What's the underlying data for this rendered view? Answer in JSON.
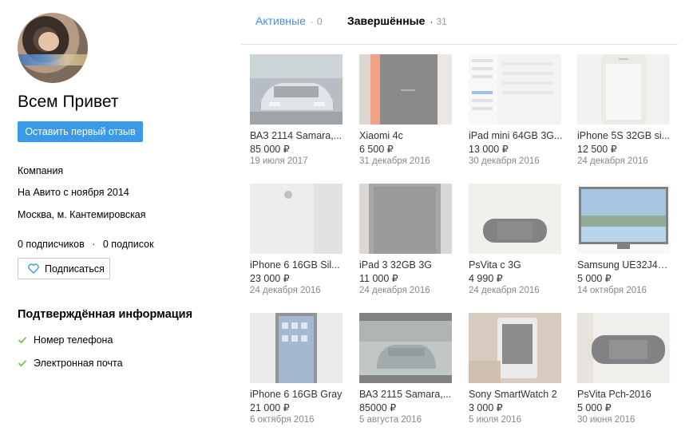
{
  "profile": {
    "name": "Всем Привет",
    "review_button": "Оставить первый отзыв",
    "type": "Компания",
    "since": "На Авито с ноября 2014",
    "location": "Москва, м. Кантемировская",
    "followers": "0 подписчиков",
    "separator": "·",
    "following": "0 подписок",
    "subscribe_button": "Подписаться"
  },
  "verified": {
    "title": "Подтверждённая информация",
    "items": [
      "Номер телефона",
      "Электронная почта"
    ]
  },
  "tabs": [
    {
      "label": "Активные",
      "count": "0",
      "dot": "·"
    },
    {
      "label": "Завершённые",
      "count": "31",
      "dot": "·"
    }
  ],
  "listings": [
    {
      "title": "ВАЗ 2114 Samara,...",
      "price": "85 000 ₽",
      "date": "19 июля 2017",
      "icon": "car-photo"
    },
    {
      "title": "Xiaomi 4c",
      "price": "6 500 ₽",
      "date": "31 декабря 2016",
      "icon": "phone-box-photo"
    },
    {
      "title": "iPad mini 64GB 3G...",
      "price": "13 000 ₽",
      "date": "30 декабря 2016",
      "icon": "tablet-settings-photo"
    },
    {
      "title": "iPhone 5S 32GB si...",
      "price": "12 500 ₽",
      "date": "24 декабря 2016",
      "icon": "phone-front-photo"
    },
    {
      "title": "iPhone 6 16GB Sil...",
      "price": "23 000 ₽",
      "date": "24 декабря 2016",
      "icon": "phone-back-photo"
    },
    {
      "title": "iPad 3 32GB 3G",
      "price": "11 000 ₽",
      "date": "24 декабря 2016",
      "icon": "tablet-photo"
    },
    {
      "title": "PsVita с 3G",
      "price": "4 990 ₽",
      "date": "24 декабря 2016",
      "icon": "console-photo"
    },
    {
      "title": "Samsung UE32J45...",
      "price": "5 000 ₽",
      "date": "14 октября 2016",
      "icon": "tv-photo"
    },
    {
      "title": "iPhone 6 16GB Gray",
      "price": "21 000 ₽",
      "date": "6 октября 2016",
      "icon": "phone-screen-photo"
    },
    {
      "title": "ВАЗ 2115 Samara,...",
      "price": "85000 ₽",
      "date": "5 августа 2016",
      "icon": "car-street-photo"
    },
    {
      "title": "Sony SmartWatch 2",
      "price": "3 000 ₽",
      "date": "5 июля 2016",
      "icon": "watch-photo"
    },
    {
      "title": "PsVita Pch-2016",
      "price": "5 000 ₽",
      "date": "30 июня 2016",
      "icon": "console-table-photo"
    }
  ],
  "colors": {
    "accent": "#3b9ae8",
    "active_tab": "#4a90d9",
    "check": "#7cc23c"
  }
}
